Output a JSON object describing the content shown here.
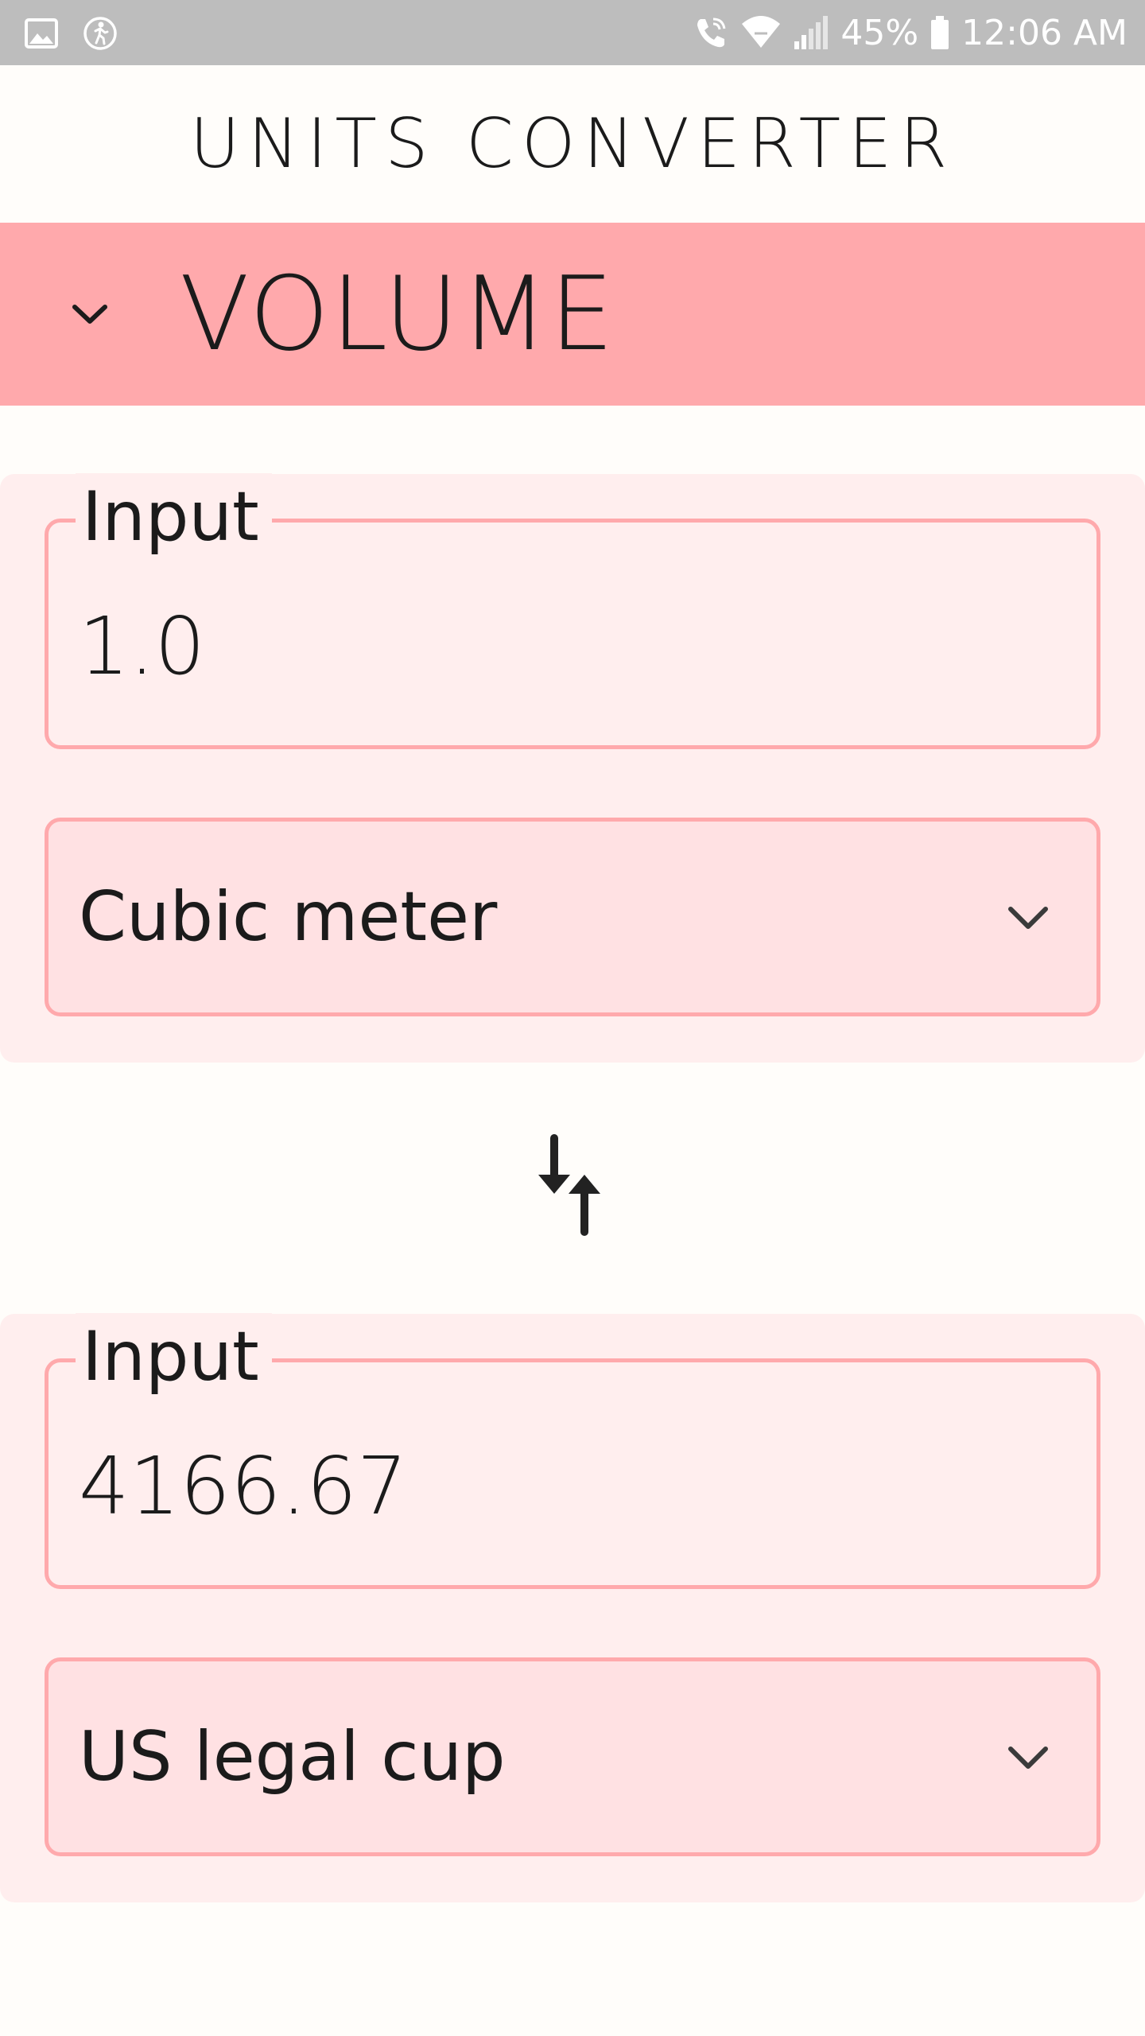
{
  "status_bar": {
    "left_icons": [
      "image-icon",
      "accessibility-icon"
    ],
    "right_icons": [
      "wifi-call-icon",
      "wifi-icon",
      "signal-icon",
      "battery-icon"
    ],
    "battery": "45%",
    "time": "12:06 AM"
  },
  "app": {
    "title": "UNITS CONVERTER"
  },
  "category": {
    "label": "VOLUME",
    "icon": "chevron-down-icon"
  },
  "converter": {
    "from": {
      "label": "Input",
      "value": "1.0",
      "unit": "Cubic meter"
    },
    "swap_icon": "swap-vertical-icon",
    "to": {
      "label": "Input",
      "value": "4166.67",
      "unit": "US legal cup"
    }
  },
  "colors": {
    "status_bar": "#bdbdbd",
    "accent": "#ffa9ac",
    "card_background": "#ffeeee",
    "select_background": "#ffe1e3",
    "page_background": "#fffdfa",
    "text": "#1b1b1b"
  }
}
